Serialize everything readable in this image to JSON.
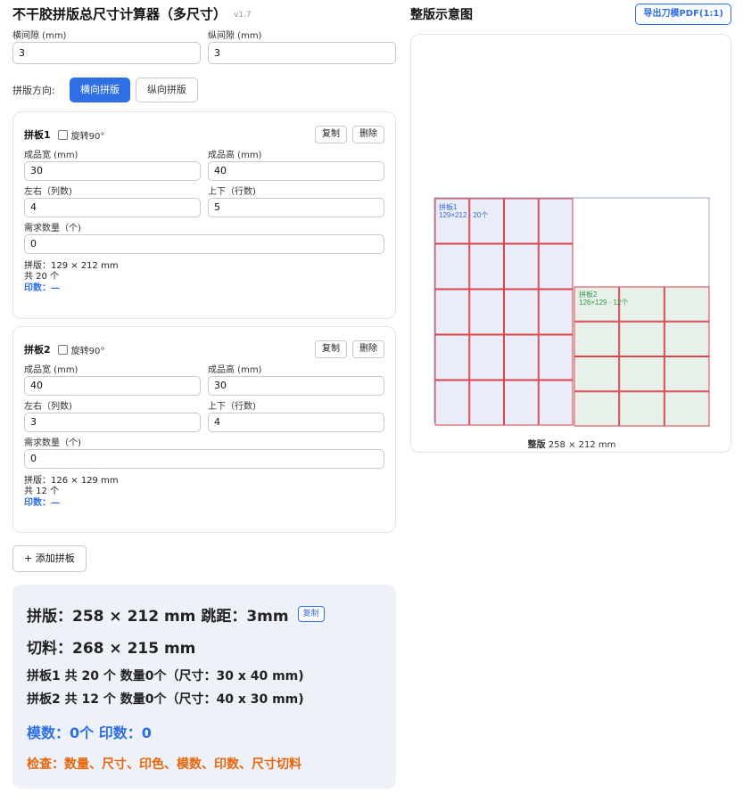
{
  "app": {
    "title": "不干胶拼版总尺寸计算器（多尺寸）",
    "version": "v1.7"
  },
  "gap": {
    "h_label": "横间隙 (mm)",
    "h_value": "3",
    "v_label": "纵间隙 (mm)",
    "v_value": "3"
  },
  "direction": {
    "label": "拼版方向:",
    "horizontal": "横向拼版",
    "vertical": "纵向拼版",
    "selected": "横向拼版"
  },
  "common": {
    "rotate_label": "旋转90°",
    "copy_label": "复制",
    "delete_label": "删除",
    "width_label": "成品宽 (mm)",
    "height_label": "成品高 (mm)",
    "cols_label": "左右（列数)",
    "rows_label": "上下（行数)",
    "qty_label": "需求数量（个)"
  },
  "panels": [
    {
      "title": "拼板1",
      "width": "30",
      "height": "40",
      "cols": "4",
      "rows": "5",
      "qty": "0",
      "size_text": "拼版：129 × 212 mm",
      "count_text": "共 20 个",
      "print_text": "印数：—",
      "preview_label_name": "拼板1",
      "preview_label_detail": "129×212 · 20个"
    },
    {
      "title": "拼板2",
      "width": "40",
      "height": "30",
      "cols": "3",
      "rows": "4",
      "qty": "0",
      "size_text": "拼版：126 × 129 mm",
      "count_text": "共 12 个",
      "print_text": "印数：—",
      "preview_label_name": "拼板2",
      "preview_label_detail": "126×129 · 12个"
    }
  ],
  "add_button": "+ 添加拼板",
  "summary": {
    "line1": "拼版：258 × 212 mm 跳距：3mm",
    "copy_badge": "复制",
    "line2": "切料：268 × 215 mm",
    "detail1": "拼板1 共 20 个 数量0个（尺寸：30 x 40 mm)",
    "detail2": "拼板2 共 12 个 数量0个（尺寸：40 x 30 mm)",
    "mould": "模数：0个 印数：0",
    "check": "检查：数量、尺寸、印色、模数、印数、尺寸切料"
  },
  "preview": {
    "title": "整版示意图",
    "export_button": "导出刀模PDF(1:1)",
    "caption_bold": "整版",
    "caption_size": "258 × 212 mm"
  },
  "colors": {
    "accent": "#2f6fe4",
    "warning": "#e8650c",
    "cell_border": "#d9414b",
    "panel1_fill": "#e9edf7",
    "panel1_label": "#3a64d8",
    "panel2_fill": "#e7f1ea",
    "panel2_label": "#2e9a4a"
  }
}
